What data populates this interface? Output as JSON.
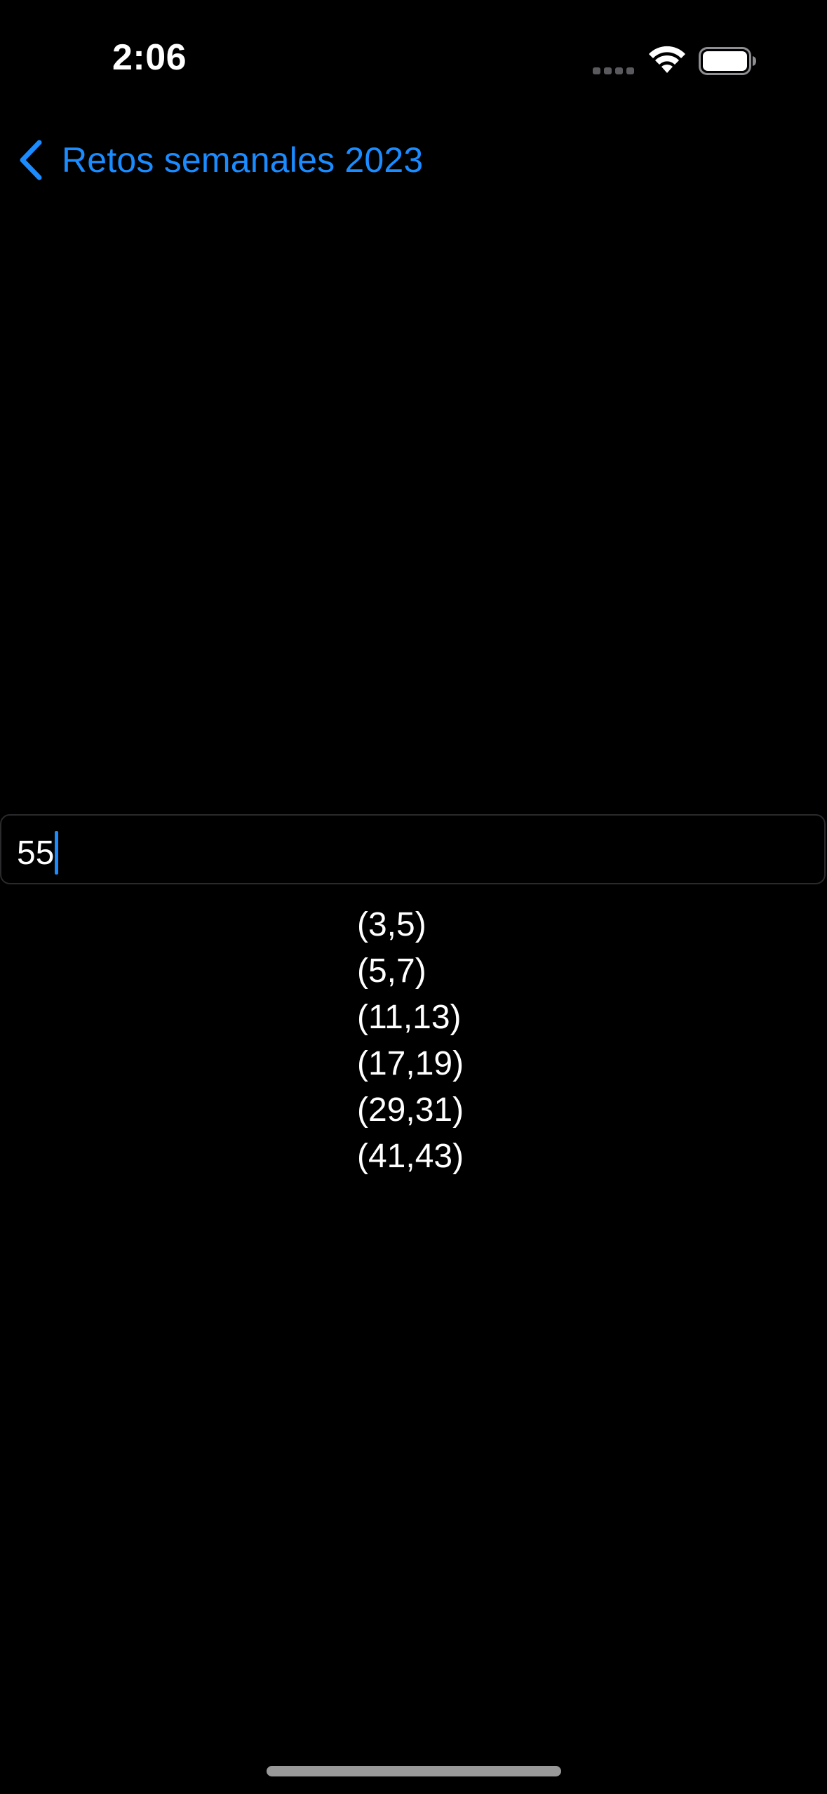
{
  "status_bar": {
    "time": "2:06"
  },
  "nav": {
    "back_label": "Retos semanales 2023"
  },
  "input": {
    "value": "55"
  },
  "results": [
    "(3,5)",
    "(5,7)",
    "(11,13)",
    "(17,19)",
    "(29,31)",
    "(41,43)"
  ],
  "icons": {
    "back": "chevron-left-icon",
    "wifi": "wifi-icon",
    "battery": "battery-icon",
    "signal": "cellular-signal-icon"
  },
  "colors": {
    "background": "#000000",
    "accent": "#1a8cff",
    "text": "#ffffff",
    "field_border": "#2a2a2c"
  }
}
